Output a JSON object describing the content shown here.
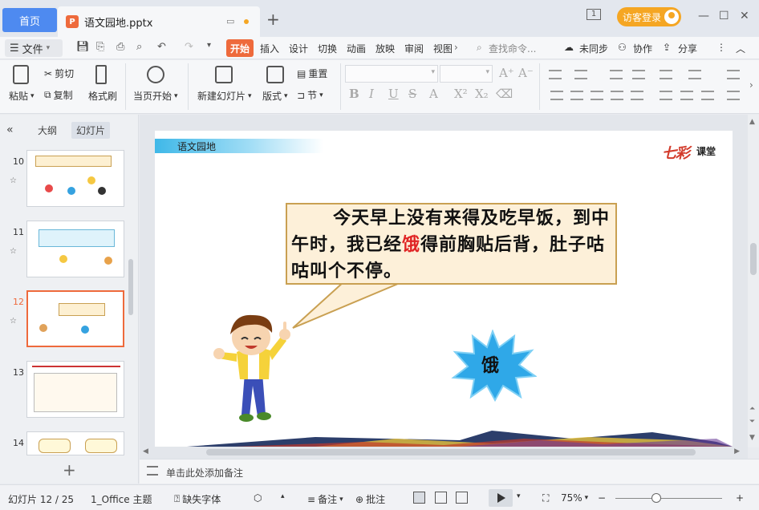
{
  "titlebar": {
    "home_tab": "首页",
    "doc_tab_title": "语文园地.pptx",
    "login_button": "访客登录",
    "window_badge": "1"
  },
  "menubar": {
    "file": "文件",
    "tabs": [
      "开始",
      "插入",
      "设计",
      "切换",
      "动画",
      "放映",
      "审阅",
      "视图"
    ],
    "search_placeholder": "查找命令...",
    "unsync": "未同步",
    "collab": "协作",
    "share": "分享"
  },
  "ribbon": {
    "paste": "粘贴",
    "cut": "剪切",
    "copy": "复制",
    "format_painter": "格式刷",
    "from_current": "当页开始",
    "new_slide": "新建幻灯片",
    "layout": "版式",
    "reset": "重置",
    "section": "节"
  },
  "left_panel": {
    "tab_outline": "大纲",
    "tab_slides": "幻灯片",
    "slide_numbers": [
      "10",
      "11",
      "12",
      "13",
      "14"
    ],
    "selected_slide": "12"
  },
  "slide": {
    "header_title": "语文园地",
    "logo": "七彩",
    "logo_sub": "课堂",
    "bubble_text_before": "今天早上没有来得及吃早饭，到中午时，我已经",
    "bubble_text_highlight": "饿",
    "bubble_text_after": "得前胸贴后背，肚子咕咕叫个不停。",
    "starburst_char": "饿"
  },
  "notes": {
    "placeholder": "单击此处添加备注"
  },
  "statusbar": {
    "slide_info": "幻灯片 12 / 25",
    "theme": "1_Office 主题",
    "missing_font": "缺失字体",
    "notes": "备注",
    "comments": "批注",
    "zoom": "75%"
  },
  "colors": {
    "accent_orange": "#ee6a3c",
    "home_blue": "#4e8af0",
    "login_orange": "#f5a623",
    "starburst_blue": "#2fa8e8"
  }
}
